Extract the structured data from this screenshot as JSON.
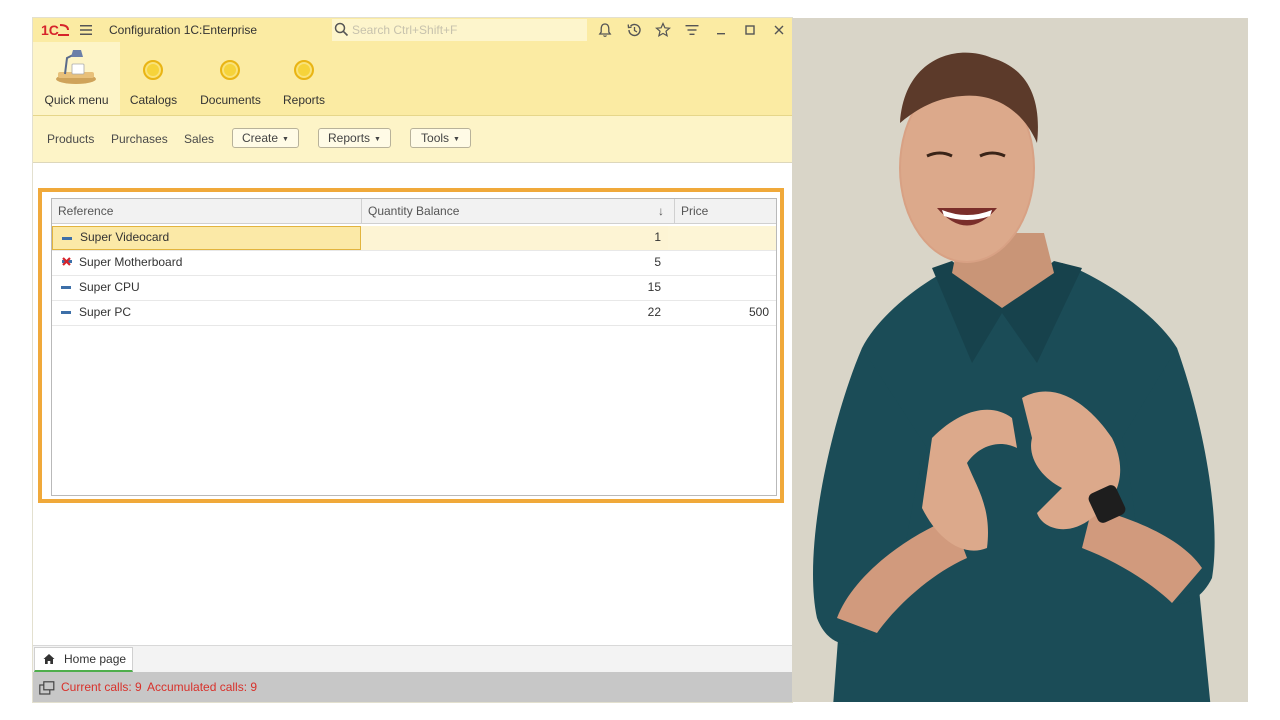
{
  "window": {
    "title": "Configuration 1C:Enterprise",
    "logo_text": "1C",
    "search_placeholder": "Search Ctrl+Shift+F"
  },
  "sections": [
    {
      "label": "Quick menu",
      "icon": "desk-lamp-icon",
      "active": true
    },
    {
      "label": "Catalogs",
      "icon": "yellow-circle-icon"
    },
    {
      "label": "Documents",
      "icon": "yellow-circle-icon"
    },
    {
      "label": "Reports",
      "icon": "yellow-circle-icon"
    }
  ],
  "nav": {
    "links": [
      "Products",
      "Purchases",
      "Sales"
    ],
    "buttons": [
      "Create",
      "Reports",
      "Tools"
    ]
  },
  "table": {
    "columns": [
      "Reference",
      "Quantity Balance",
      "Price"
    ],
    "sort_indicator": "↓",
    "rows": [
      {
        "reference": "Super Videocard",
        "quantity": "1",
        "price": "",
        "icon": "item-icon",
        "selected": true
      },
      {
        "reference": "Super Motherboard",
        "quantity": "5",
        "price": "",
        "icon": "item-marked-icon"
      },
      {
        "reference": "Super CPU",
        "quantity": "15",
        "price": "",
        "icon": "item-icon"
      },
      {
        "reference": "Super PC",
        "quantity": "22",
        "price": "500",
        "icon": "item-icon"
      }
    ]
  },
  "open_windows": {
    "home_tab": "Home page"
  },
  "status": {
    "current_calls": "Current calls: 9",
    "accumulated_calls": "Accumulated calls: 9"
  },
  "colors": {
    "panel_yellow": "#fbeba3",
    "highlight_orange": "#f0a93a",
    "status_red": "#d8312b",
    "presenter_background": "#d9d5c8"
  }
}
